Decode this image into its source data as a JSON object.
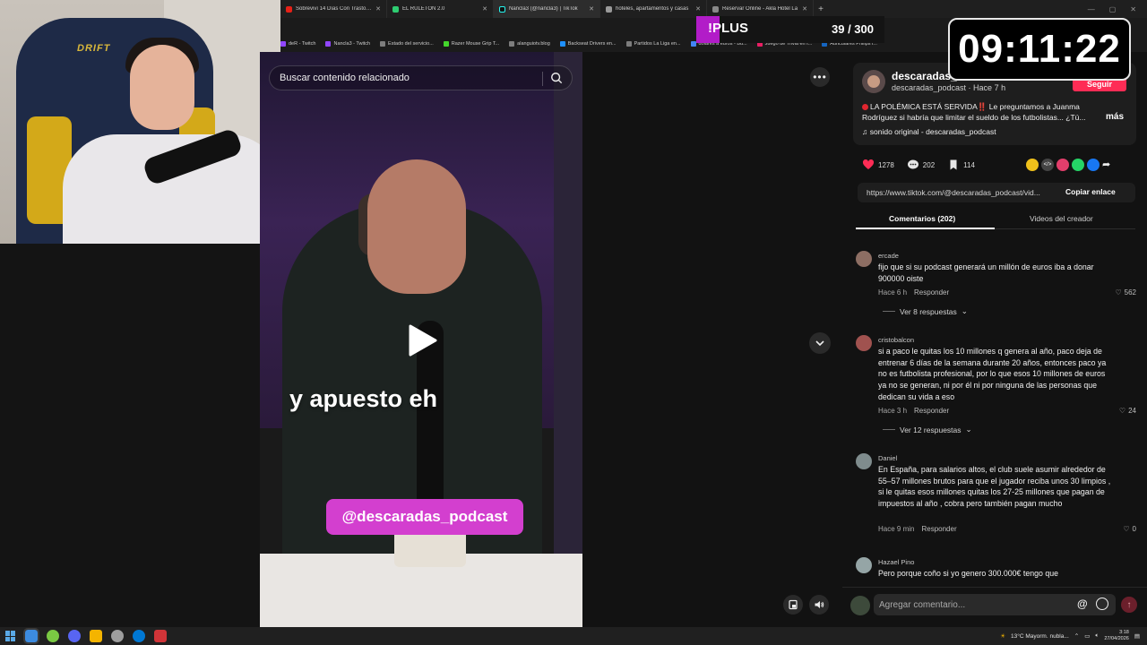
{
  "browser": {
    "tabs": [
      {
        "title": "Sobreviví 14 Días Con Trastorno",
        "color": "#e62117"
      },
      {
        "title": "EL RULETON 2.0",
        "color": "#2ecc71"
      },
      {
        "title": "Nancla3 (@nancla3) | TikTok",
        "color": "#111111",
        "active": true
      },
      {
        "title": "hoteles, apartamentos y casas",
        "color": "#999999"
      },
      {
        "title": "Reservar Online - Akla Hotel La",
        "color": "#888888"
      }
    ],
    "new_tab": "+",
    "bookmarks": [
      "deR - Twitch",
      "Nancla3 - Twitch",
      "Estado del servicio...",
      "Razer Mouse Grip T...",
      "alanguiotv.blog",
      "Backseat Drivers en...",
      "Partidos La Liga en...",
      "dolares a euros - Bu...",
      "Juego de Trivia en I...",
      "Auriculares Philips l..."
    ]
  },
  "overlay": {
    "plus_label": "!PLUS",
    "plus_count": "39 / 300",
    "clock": "09:11:22",
    "webcam_brand": "DRIFT"
  },
  "video": {
    "search_placeholder": "Buscar contenido relacionado",
    "caption": "y apuesto eh",
    "handle": "@descaradas_podcast",
    "more": "•••"
  },
  "post": {
    "author": "descaradas_",
    "author_sub": "descaradas_podcast · Hace 7 h",
    "follow": "Seguir",
    "description": "LA POLÉMICA ESTÁ SERVIDA‼️ Le preguntamos a Juanma Rodríguez si habría que limitar el sueldo de los futbolistas... ¿Tú...",
    "more": "más",
    "sound": "sonido original - descaradas_podcast",
    "likes": "1278",
    "comments": "202",
    "saves": "114",
    "link": "https://www.tiktok.com/@descaradas_podcast/vid...",
    "copy_link": "Copiar enlace",
    "share_colors": [
      "#f0c11b",
      "#444444",
      "#e23e6b",
      "#25d366",
      "#1877f2"
    ],
    "tab_comments": "Comentarios (202)",
    "tab_creator": "Videos del creador"
  },
  "comments": [
    {
      "user": "ercade",
      "text": "fijo que si su podcast generará un millón de euros iba a donar 900000 oiste",
      "time": "Hace 6 h",
      "reply": "Responder",
      "likes": "562",
      "replies": "Ver 8 respuestas",
      "avatar_color": "#8d6e63"
    },
    {
      "user": "cristobalcon",
      "text": "si a paco le quitas los 10 millones q genera al año, paco deja de entrenar 6 días de la semana durante 20 años, entonces paco ya no es futbolista profesional, por lo que esos 10 millones de euros ya no se generan, ni por él ni por ninguna de las personas que dedican su vida a eso",
      "time": "Hace 3 h",
      "reply": "Responder",
      "likes": "24",
      "replies": "Ver 12 respuestas",
      "avatar_color": "#a0524f"
    },
    {
      "user": "Daniel",
      "text": "En España, para salarios altos, el club suele asumir alrededor de 55–57 millones brutos para que el jugador reciba unos 30 limpios , si le quitas esos millones quitas los 27-25 millones que pagan de impuestos al año , cobra pero también pagan mucho",
      "time": "Hace 9 min",
      "reply": "Responder",
      "likes": "0",
      "replies": "",
      "avatar_color": "#7f8c8d"
    },
    {
      "user": "Hazael Pino",
      "text": "Pero porque coño si yo genero 300.000€ tengo que",
      "time": "",
      "reply": "",
      "likes": "",
      "replies": "",
      "avatar_color": "#95a5a6"
    }
  ],
  "add_comment": {
    "placeholder": "Agregar comentario...",
    "at": "@"
  },
  "taskbar": {
    "weather": "13°C  Mayorm. nubla...",
    "time": "3:18",
    "date": "27/04/2026",
    "icon_colors": [
      "#3c8be0",
      "#7ac943",
      "#5865f2",
      "#f4b400",
      "#9e9e9e",
      "#0078d4",
      "#d13438"
    ]
  }
}
